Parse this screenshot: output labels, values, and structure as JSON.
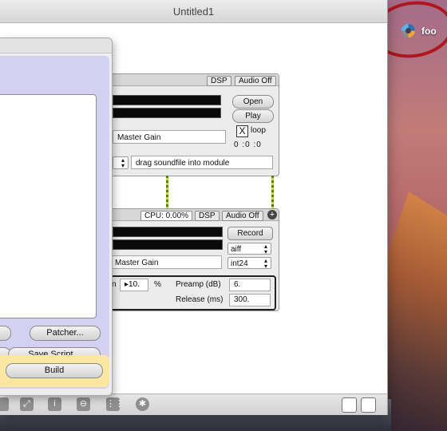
{
  "window": {
    "title": "Untitled1"
  },
  "desktop": {
    "icon_label": "foo",
    "icon_name": "max-app-icon"
  },
  "player_module": {
    "dsp_label": "DSP",
    "audio_label": "Audio Off",
    "open_label": "Open",
    "play_label": "Play",
    "loop_label": "loop",
    "loop_checked": "X",
    "time": "0 :0 :0",
    "gain_label": "Master Gain",
    "drop_hint": "drag soundfile into module"
  },
  "recorder_module": {
    "cpu_label": "CPU: 0.00%",
    "dsp_label": "DSP",
    "audio_label": "Audio Off",
    "record_label": "Record",
    "format_value": "aiff",
    "bitdepth_value": "int24",
    "gain_label": "Master Gain",
    "number_prefix": "n",
    "number_value": "10.",
    "number_unit": "%",
    "preamp_label": "Preamp (dB)",
    "preamp_value": "6.",
    "release_label": "Release (ms)",
    "release_value": "300."
  },
  "panel": {
    "patcher_label": "Patcher...",
    "save_script_label": "Save Script...",
    "build_label": "Build"
  },
  "colors": {
    "panel_purple": "#d4d0f3",
    "panel_yellow": "#fbe7a1",
    "highlight_ring": "#b0161d"
  }
}
